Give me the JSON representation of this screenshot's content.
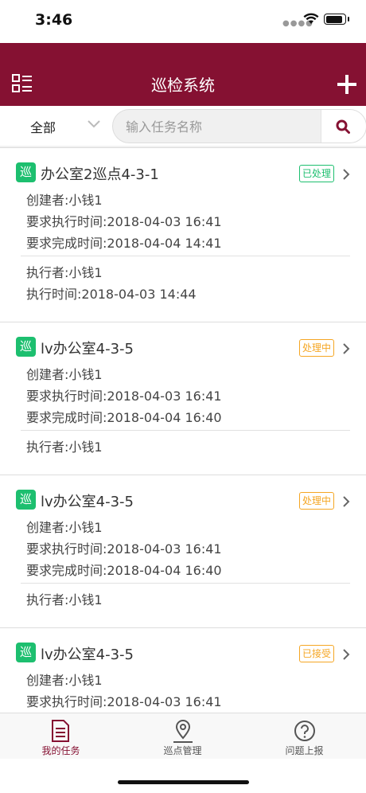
{
  "status_bar": {
    "time": "3:46"
  },
  "header": {
    "title": "巡检系统"
  },
  "filter": {
    "scope_label": "全部",
    "search_placeholder": "输入任务名称"
  },
  "tasks": [
    {
      "badge": "巡",
      "name": "办公室2巡点4-3-1",
      "status": "已处理",
      "status_color": "#1dbf6f",
      "creator": "创建者:小钱1",
      "exec_required": "要求执行时间:2018-04-03 16:41",
      "finish_required": "要求完成时间:2018-04-04 14:41",
      "executor": "执行者:小钱1",
      "exec_time": "执行时间:2018-04-03 14:44"
    },
    {
      "badge": "巡",
      "name": "lv办公室4-3-5",
      "status": "处理中",
      "status_color": "#f5a623",
      "creator": "创建者:小钱1",
      "exec_required": "要求执行时间:2018-04-03 16:41",
      "finish_required": "要求完成时间:2018-04-04 16:40",
      "executor": "执行者:小钱1"
    },
    {
      "badge": "巡",
      "name": "lv办公室4-3-5",
      "status": "处理中",
      "status_color": "#f5a623",
      "creator": "创建者:小钱1",
      "exec_required": "要求执行时间:2018-04-03 16:41",
      "finish_required": "要求完成时间:2018-04-04 16:40",
      "executor": "执行者:小钱1"
    },
    {
      "badge": "巡",
      "name": "lv办公室4-3-5",
      "status": "已接受",
      "status_color": "#f5a623",
      "creator": "创建者:小钱1",
      "exec_required": "要求执行时间:2018-04-03 16:41"
    }
  ],
  "tabbar": {
    "tabs": [
      {
        "label": "我的任务",
        "icon": "document-icon",
        "active": true
      },
      {
        "label": "巡点管理",
        "icon": "map-pin-icon",
        "active": false
      },
      {
        "label": "问题上报",
        "icon": "question-icon",
        "active": false
      }
    ]
  },
  "colors": {
    "brand": "#851132",
    "done": "#1dbf6f",
    "pending": "#f5a623"
  }
}
